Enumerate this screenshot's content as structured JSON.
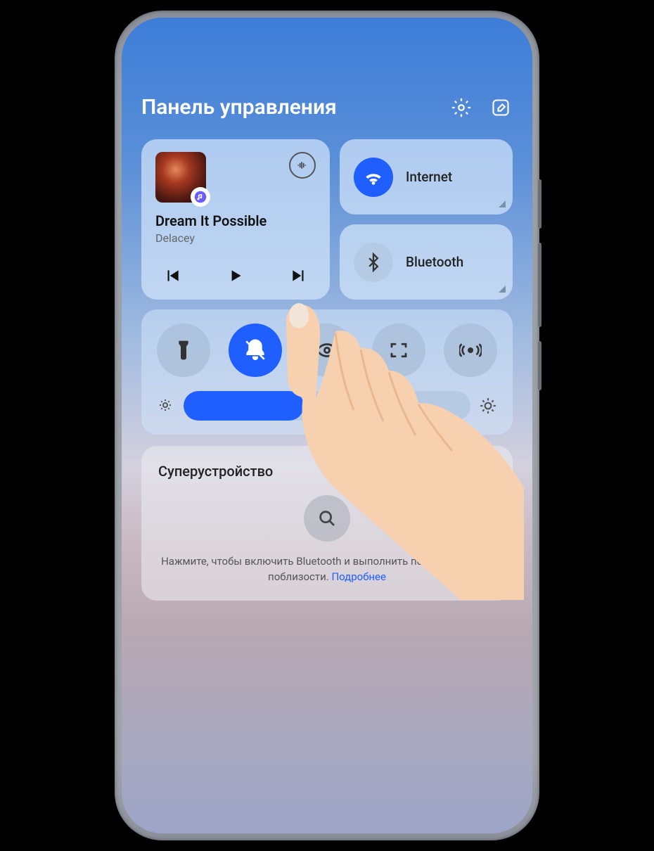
{
  "header": {
    "title": "Панель управления"
  },
  "media": {
    "song": "Dream It Possible",
    "artist": "Delacey"
  },
  "connectivity": {
    "internet": {
      "label": "Internet"
    },
    "bluetooth": {
      "label": "Bluetooth"
    }
  },
  "super_device": {
    "title": "Суперустройство",
    "hint": "Нажмите, чтобы включить Bluetooth и выполнить поиск устройств поблизости. ",
    "link": "Подробнее"
  },
  "brightness_percent": 42
}
